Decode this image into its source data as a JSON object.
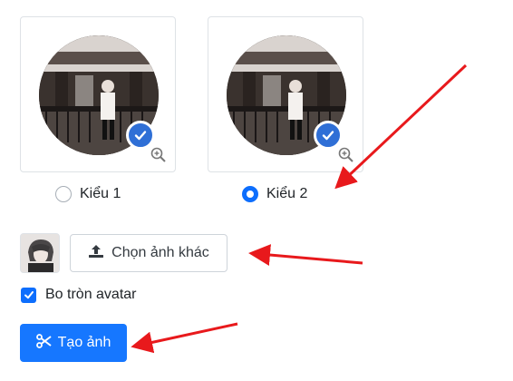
{
  "avatar_options": [
    {
      "label": "Kiểu 1",
      "selected": false
    },
    {
      "label": "Kiểu 2",
      "selected": true
    }
  ],
  "upload_button": {
    "label": "Chọn ảnh khác",
    "icon": "upload-icon"
  },
  "round_avatar": {
    "label": "Bo tròn avatar",
    "checked": true
  },
  "create_button": {
    "label": "Tạo ảnh",
    "icon": "scissors-icon"
  },
  "colors": {
    "primary": "#0d6efd",
    "check_badge": "#2f6fd6",
    "annotation_arrow": "#e8191c"
  }
}
